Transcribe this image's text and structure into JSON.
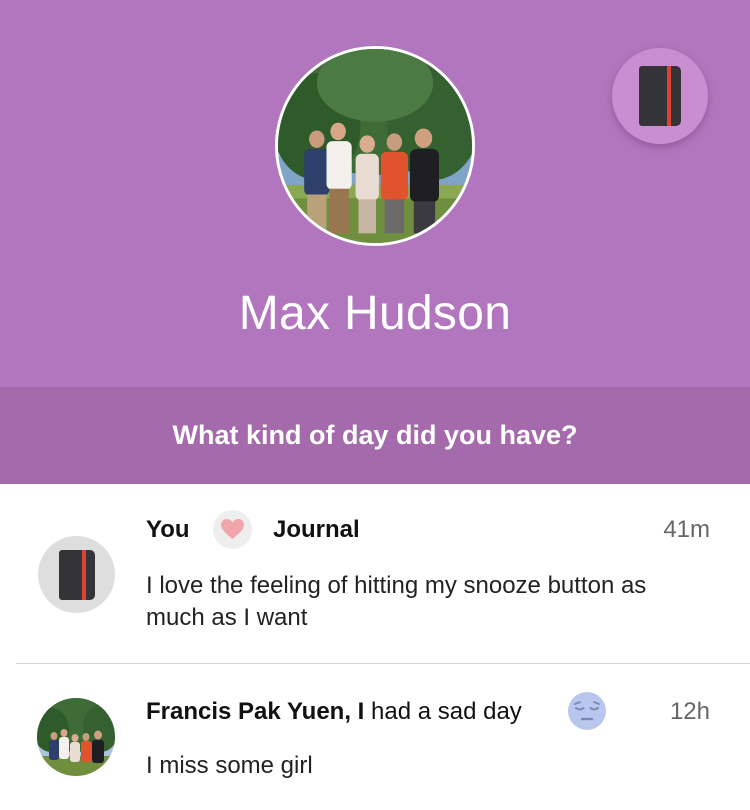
{
  "profile": {
    "name": "Max Hudson"
  },
  "prompt": {
    "text": "What kind of day did you have?"
  },
  "colors": {
    "header": "#b176bd",
    "prompt_bar": "#a56aac",
    "fab": "#c98dd2",
    "notebook_strap": "#e04231"
  },
  "icons": {
    "fab": "journal-notebook-icon",
    "heart": "heart-icon",
    "sad_face": "sad-face-emoji"
  },
  "feed": [
    {
      "author": "You",
      "target": "Journal",
      "time": "41m",
      "text": "I love the feeling of hitting my snooze button as much as I want"
    },
    {
      "author": "Francis Pak Yuen, I",
      "mood_text": " had a sad day",
      "time": "12h",
      "text": "I miss some girl"
    }
  ]
}
